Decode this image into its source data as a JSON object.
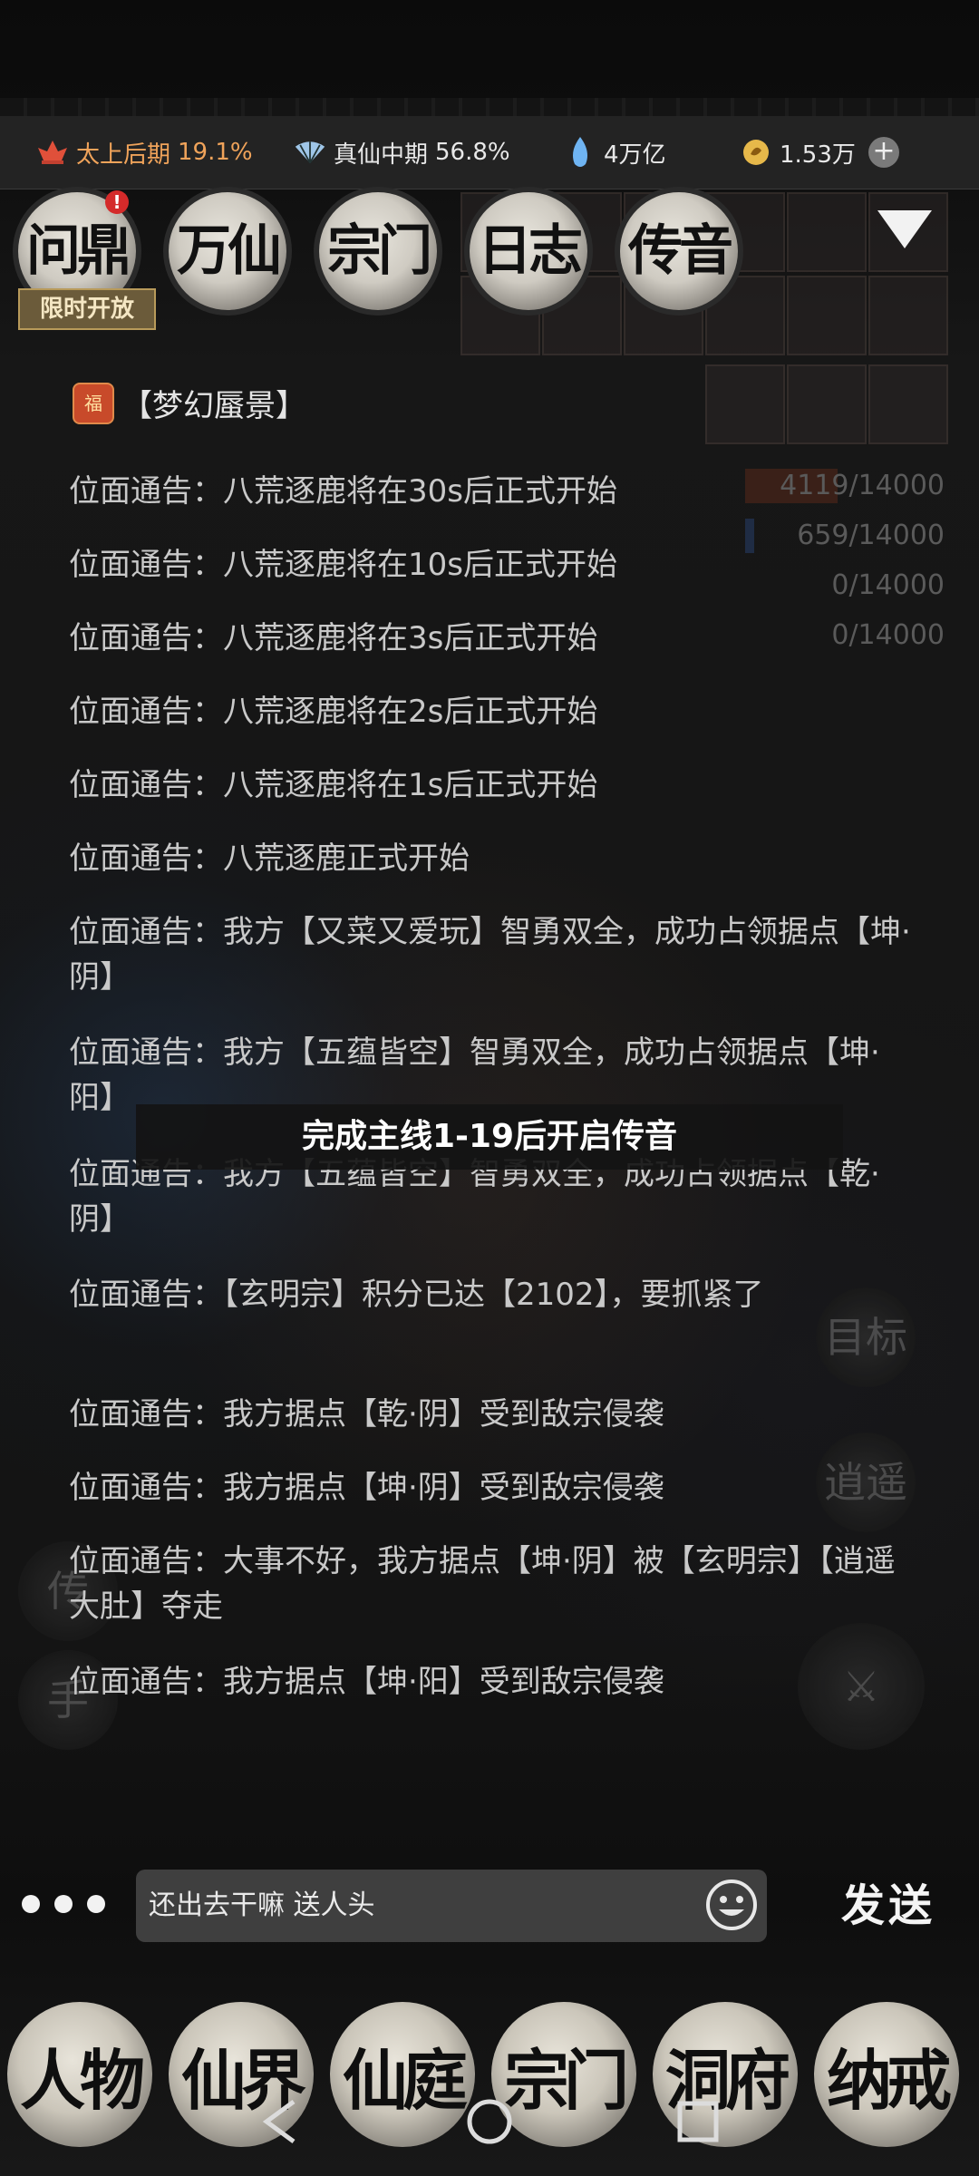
{
  "resources": {
    "realm1": {
      "label": "太上后期",
      "percent": "19.1%"
    },
    "realm2": {
      "label": "真仙中期",
      "percent": "56.8%"
    },
    "spirit_stones": "4万亿",
    "coins": "1.53万"
  },
  "top_nav": {
    "items": [
      {
        "label": "问鼎",
        "badge": "!"
      },
      {
        "label": "万仙"
      },
      {
        "label": "宗门"
      },
      {
        "label": "日志"
      },
      {
        "label": "传音"
      }
    ],
    "limited_tag": "限时开放"
  },
  "progress_panel": [
    {
      "value": "4119/14000",
      "fill": 0.294
    },
    {
      "value": "659/14000",
      "fill": 0.047
    },
    {
      "value": "0/14000",
      "fill": 0
    },
    {
      "value": "0/14000",
      "fill": 0
    }
  ],
  "chat": {
    "room_icon_text": "福",
    "room_name": "【梦幻蜃景】",
    "messages": [
      "位面通告：八荒逐鹿将在30s后正式开始",
      "位面通告：八荒逐鹿将在10s后正式开始",
      "位面通告：八荒逐鹿将在3s后正式开始",
      "位面通告：八荒逐鹿将在2s后正式开始",
      "位面通告：八荒逐鹿将在1s后正式开始",
      "位面通告：八荒逐鹿正式开始",
      "位面通告：我方【又菜又爱玩】智勇双全，成功占领据点【坤·阴】",
      "位面通告：我方【五蕴皆空】智勇双全，成功占领据点【坤·阳】",
      "位面通告：我方【五蕴皆空】智勇双全，成功占领据点【乾·阴】",
      "位面通告：【玄明宗】积分已达【2102】，要抓紧了",
      "位面通告：我方据点【乾·阴】受到敌宗侵袭",
      "位面通告：我方据点【坤·阴】受到敌宗侵袭",
      "位面通告：大事不好，我方据点【坤·阴】被【玄明宗】【逍遥大肚】夺走",
      "位面通告：我方据点【坤·阳】受到敌宗侵袭"
    ],
    "toast": "完成主线1-19后开启传音"
  },
  "input": {
    "value": "还出去干嘛  送人头",
    "send_label": "发送"
  },
  "bottom_nav": [
    "人物",
    "仙界",
    "仙庭",
    "宗门",
    "洞府",
    "纳戒"
  ],
  "colors": {
    "accent": "#f0a35a",
    "toast_bg": "#141414",
    "input_bg": "#3f3f3f"
  }
}
